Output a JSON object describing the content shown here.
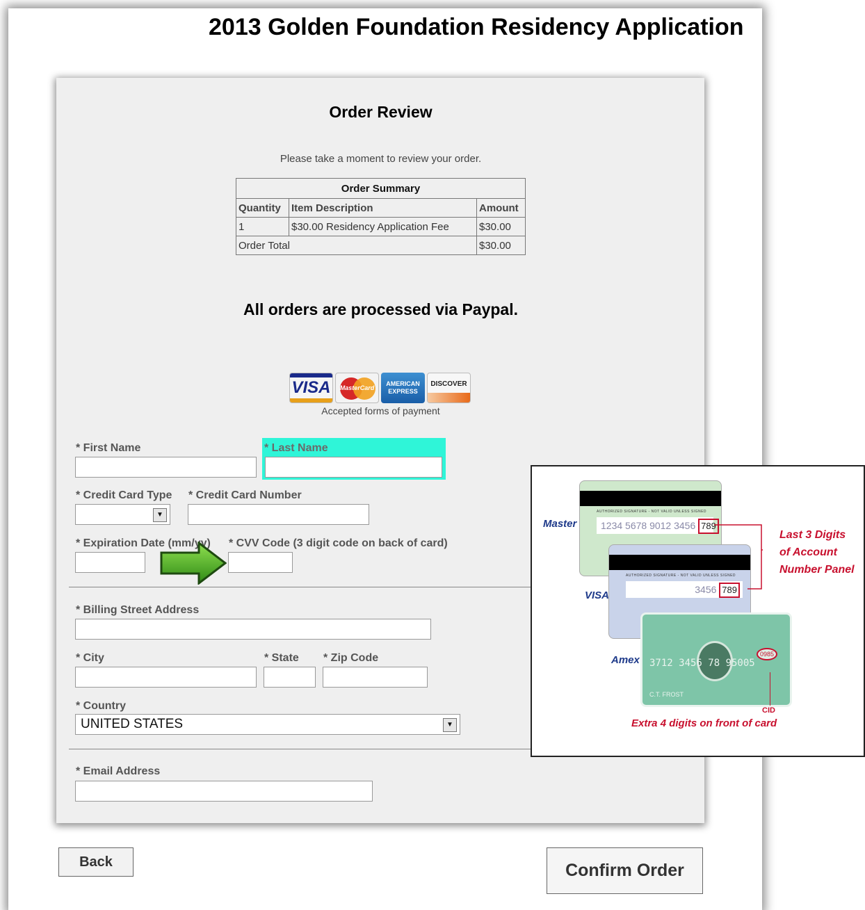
{
  "page_title": "2013 Golden Foundation Residency Application",
  "order_review": {
    "title": "Order Review",
    "intro": "Please take a moment to review your order."
  },
  "order_summary": {
    "heading": "Order Summary",
    "columns": [
      "Quantity",
      "Item Description",
      "Amount"
    ],
    "rows": [
      {
        "quantity": "1",
        "description": "$30.00 Residency Application Fee",
        "amount": "$30.00"
      }
    ],
    "total_label": "Order Total",
    "total_amount": "$30.00"
  },
  "paypal_note": "All orders are processed via Paypal.",
  "payment_logos": [
    {
      "name": "VISA",
      "icon": "visa-logo"
    },
    {
      "name": "MasterCard",
      "icon": "mastercard-logo"
    },
    {
      "name": "AMERICAN EXPRESS",
      "icon": "amex-logo"
    },
    {
      "name": "DISCOVER",
      "icon": "discover-logo"
    }
  ],
  "accepted_caption": "Accepted forms of payment",
  "form": {
    "first_name_label": "* First Name",
    "first_name_value": "",
    "last_name_label": "* Last Name",
    "last_name_value": "",
    "card_type_label": "* Credit Card Type",
    "card_type_value": "",
    "card_number_label": "* Credit Card Number",
    "card_number_value": "",
    "expiration_label": "* Expiration Date (mm/yy)",
    "expiration_value": "",
    "cvv_label": "* CVV Code (3 digit code on back of card)",
    "cvv_value": "",
    "billing_address_label": "* Billing Street Address",
    "billing_address_value": "",
    "city_label": "* City",
    "city_value": "",
    "state_label": "* State",
    "state_value": "",
    "zip_label": "* Zip Code",
    "zip_value": "",
    "country_label": "* Country",
    "country_value": "UNITED STATES",
    "email_label": "* Email Address",
    "email_value": ""
  },
  "cvv_help": {
    "master_label": "Master",
    "visa_label": "VISA",
    "amex_label": "Amex",
    "master_number": "1234 5678 9012 3456",
    "master_cvv": "789",
    "visa_number": "3456",
    "visa_cvv": "789",
    "sig_strip_text": "AUTHORIZED SIGNATURE - NOT VALID UNLESS SIGNED",
    "last3_line1": "Last 3 Digits",
    "last3_line2": "of Account",
    "last3_line3": "Number Panel",
    "amex_number": "3712 3456 78 95005",
    "amex_code": "0985",
    "amex_holder": "C.T. FROST",
    "cid_label": "CID",
    "amex_note": "Extra 4 digits on front of card"
  },
  "buttons": {
    "back": "Back",
    "confirm": "Confirm Order"
  },
  "colors": {
    "panel_bg": "#efefef",
    "highlight": "#2ff5d8",
    "arrow_green": "#3aa321",
    "help_red": "#c8102e",
    "help_blue": "#1e3a8a"
  }
}
